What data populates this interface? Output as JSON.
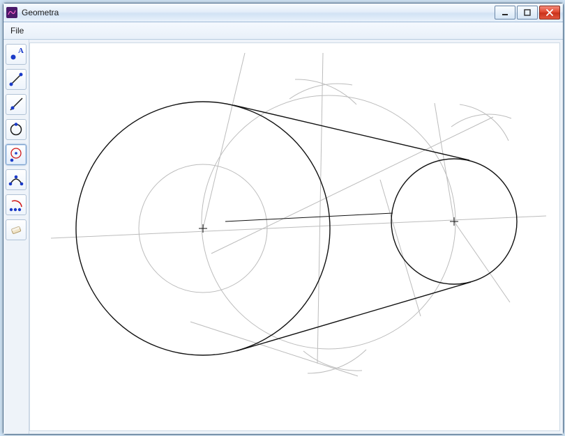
{
  "window": {
    "title": "Geometra"
  },
  "menu": {
    "file": "File"
  },
  "tools": {
    "point": "A"
  }
}
